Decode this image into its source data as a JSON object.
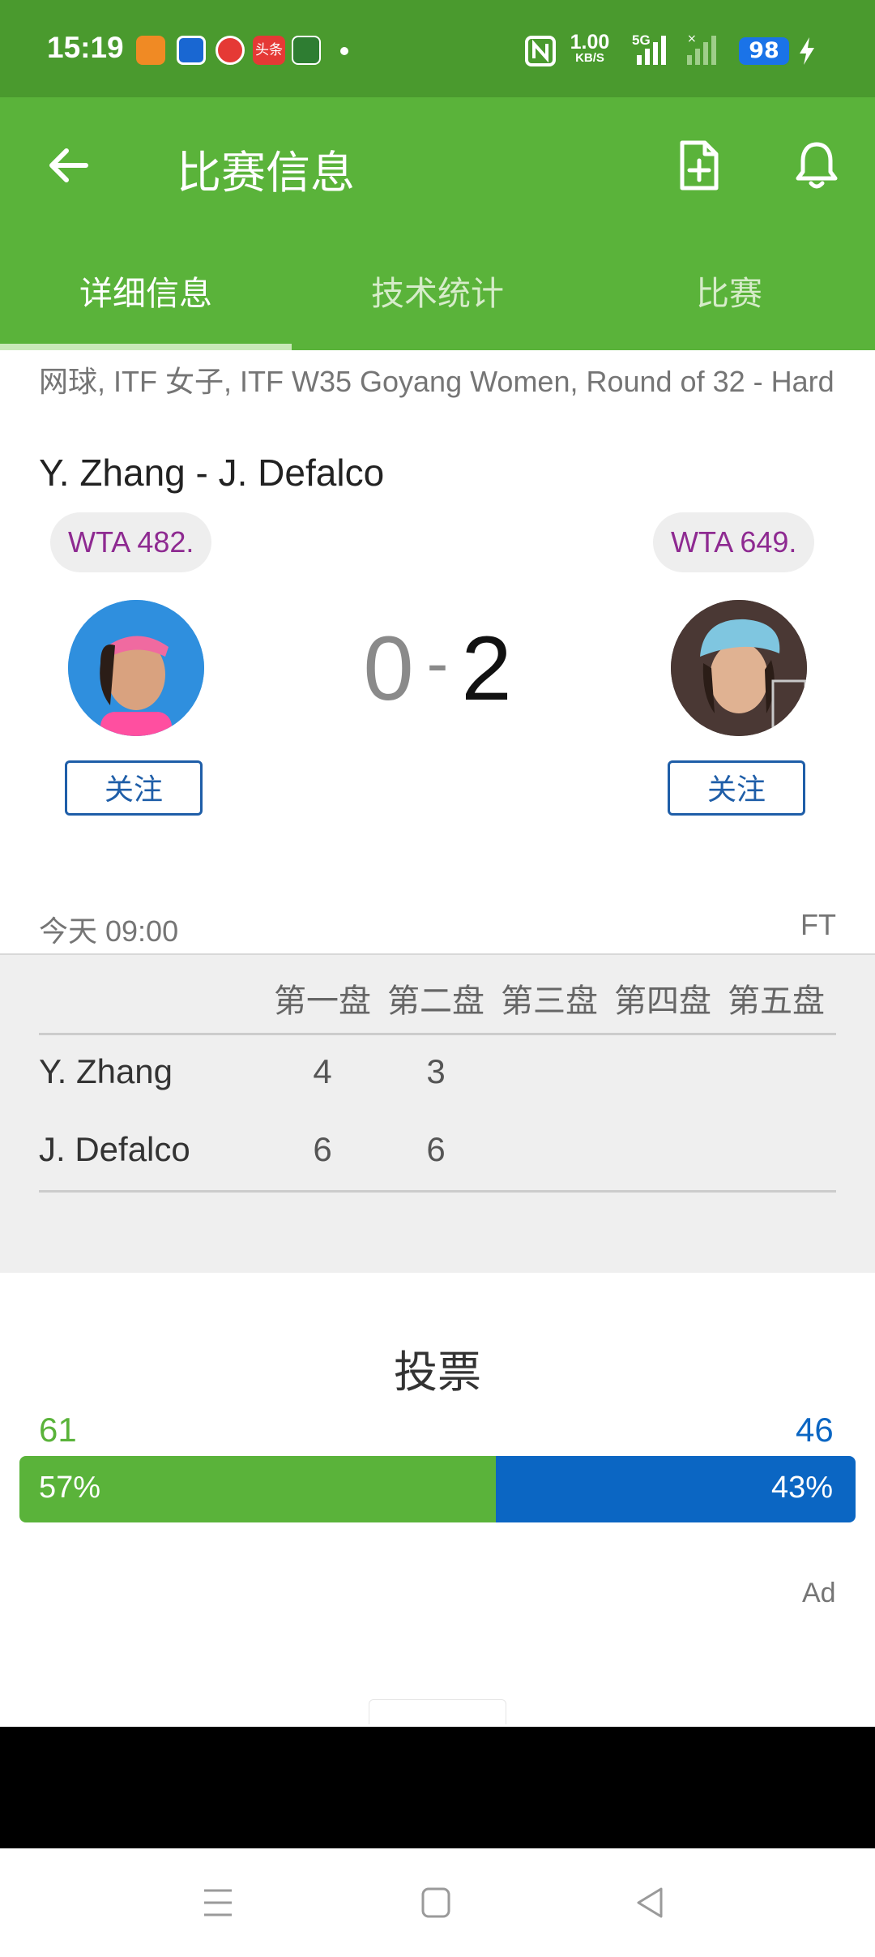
{
  "status_bar": {
    "time": "15:19",
    "net_speed_top": "1.00",
    "net_speed_unit": "KB/S",
    "network": "5G",
    "battery": "98",
    "app_badge_text": "头条"
  },
  "app_bar": {
    "title": "比赛信息",
    "back_icon": "arrow-left-icon",
    "add_icon": "add-document-icon",
    "bell_icon": "bell-icon"
  },
  "tabs": [
    {
      "label": "详细信息",
      "active": true
    },
    {
      "label": "技术统计",
      "active": false
    },
    {
      "label": "比赛",
      "active": false
    }
  ],
  "match": {
    "subtitle": "网球, ITF 女子, ITF W35 Goyang Women, Round of 32 - Hard",
    "title": "Y. Zhang - J. Defalco",
    "home": {
      "name": "Y. Zhang",
      "rank": "WTA 482.",
      "follow": "关注"
    },
    "away": {
      "name": "J. Defalco",
      "rank": "WTA 649.",
      "follow": "关注"
    },
    "score_home": "0",
    "score_sep": "-",
    "score_away": "2",
    "datetime": "今天 09:00",
    "status": "FT"
  },
  "sets": {
    "headers": [
      "第一盘",
      "第二盘",
      "第三盘",
      "第四盘",
      "第五盘"
    ],
    "rows": [
      {
        "player": "Y. Zhang",
        "scores": [
          "4",
          "3"
        ]
      },
      {
        "player": "J. Defalco",
        "scores": [
          "6",
          "6"
        ]
      }
    ]
  },
  "vote": {
    "title": "投票",
    "home_count": "61",
    "away_count": "46",
    "home_pct": "57%",
    "away_pct": "43%",
    "home_fraction": 0.57,
    "home_color": "#5ab33a",
    "away_color": "#0b66c3"
  },
  "ad_label": "Ad",
  "colors": {
    "status_bar": "#4a9a2e",
    "app_bar": "#5ab33a",
    "rank_text": "#8e2a91",
    "follow_blue": "#1f5ea8"
  }
}
